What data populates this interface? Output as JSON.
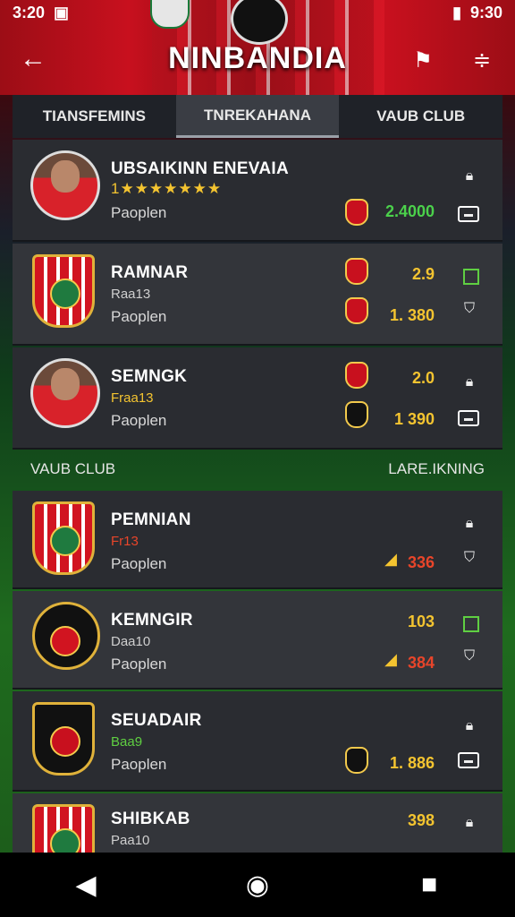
{
  "status": {
    "time_left": "3:20",
    "time_right": "9:30"
  },
  "header": {
    "title": "NINBANDIA"
  },
  "tabs": [
    {
      "label": "TIANSFEMINS"
    },
    {
      "label": "TNREKAHANA"
    },
    {
      "label": "VAUB CLUB"
    }
  ],
  "rows": [
    {
      "name": "UBSAIKINN ENEVAIA",
      "stars": "1★★★★★★★",
      "label": "Paoplen",
      "value2": "2.4000",
      "value2_color": "#4bd14b"
    },
    {
      "name": "RAMNAR",
      "sub": "Raa13",
      "label": "Paoplen",
      "value1": "2.9",
      "value2": "1. 380",
      "value2_color": "#f4c430"
    },
    {
      "name": "SEMNGK",
      "sub": "Fraa13",
      "label": "Paoplen",
      "value1": "2.0",
      "value2": "1 390",
      "value2_color": "#f4c430"
    }
  ],
  "section": {
    "left": "VAUB CLUB",
    "right": "LARE.IKNING"
  },
  "clubs": [
    {
      "name": "PEMNIAN",
      "sub": "Fr13",
      "sub_color": "#e8452a",
      "label": "Paoplen",
      "value2": "336",
      "value2_color": "#e8452a"
    },
    {
      "name": "KEMNGIR",
      "sub": "Daa10",
      "sub_color": "#cfcfcf",
      "label": "Paoplen",
      "value1": "103",
      "value2": "384",
      "value2_color": "#e8452a"
    },
    {
      "name": "SEUADAIR",
      "sub": "Baa9",
      "sub_color": "#5fcf42",
      "label": "Paoplen",
      "value2": "1. 886",
      "value2_color": "#f4c430"
    },
    {
      "name": "SHIBKAB",
      "sub": "Paa10",
      "sub_color": "#cfcfcf",
      "value1": "398"
    }
  ],
  "colors": {
    "primary_red": "#c8101e",
    "gold": "#f4c430",
    "green": "#4bd14b",
    "row_bg": "#2a2c31"
  },
  "icons": [
    "arrow-left-icon",
    "pin-icon",
    "filter-icon",
    "lock-icon",
    "card-icon",
    "shield-check-icon",
    "back-nav-icon",
    "home-nav-icon",
    "recents-nav-icon"
  ]
}
